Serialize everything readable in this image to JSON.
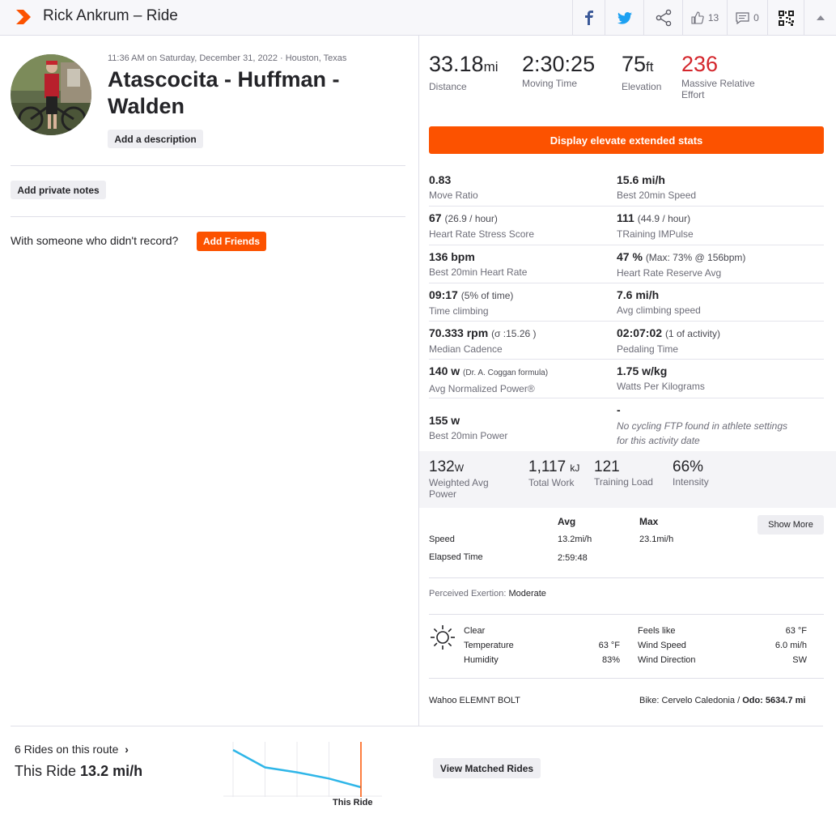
{
  "header": {
    "title": "Rick Ankrum – Ride",
    "kudos_count": "13",
    "comments_count": "0",
    "colors": {
      "brand": "#fc5200",
      "facebook": "#3b5998",
      "twitter": "#1da1f2"
    }
  },
  "activity": {
    "datetime": "11:36 AM on Saturday, December 31, 2022 · Houston, Texas",
    "title": "Atascocita - Huffman - Walden",
    "add_description": "Add a description",
    "add_private_notes": "Add private notes",
    "with_someone": "With someone who didn't record?",
    "add_friends": "Add Friends"
  },
  "summary": [
    {
      "value": "33.18",
      "unit": "mi",
      "label": "Distance"
    },
    {
      "value": "2:30:25",
      "unit": "",
      "label": "Moving Time"
    },
    {
      "value": "75",
      "unit": "ft",
      "label": "Elevation"
    },
    {
      "value": "236",
      "unit": "",
      "label": "Massive Relative Effort"
    }
  ],
  "elevate_button": "Display elevate extended stats",
  "extended": [
    {
      "left": {
        "value": "0.83",
        "extra": "",
        "label": "Move Ratio"
      },
      "right": {
        "value": "15.6 mi/h",
        "extra": "",
        "label": "Best 20min Speed"
      }
    },
    {
      "left": {
        "value": "67",
        "extra": "(26.9 / hour)",
        "label": "Heart Rate Stress Score"
      },
      "right": {
        "value": "111",
        "extra": "(44.9 / hour)",
        "label": "TRaining IMPulse"
      }
    },
    {
      "left": {
        "value": "136 bpm",
        "extra": "",
        "label": "Best 20min Heart Rate"
      },
      "right": {
        "value": "47 %",
        "extra": "(Max: 73% @ 156bpm)",
        "label": "Heart Rate Reserve Avg"
      }
    },
    {
      "left": {
        "value": "09:17",
        "extra": "(5% of time)",
        "label": "Time climbing"
      },
      "right": {
        "value": "7.6 mi/h",
        "extra": "",
        "label": "Avg climbing speed"
      }
    },
    {
      "left": {
        "value": "70.333 rpm",
        "extra": "(σ :15.26 )",
        "label": "Median Cadence"
      },
      "right": {
        "value": "02:07:02",
        "extra": "(1 of activity)",
        "label": "Pedaling Time"
      }
    },
    {
      "left": {
        "value": "140 w",
        "extra": "(Dr. A. Coggan formula)",
        "label": "Avg Normalized Power®"
      },
      "right": {
        "value": "1.75 w/kg",
        "extra": "",
        "label": "Watts Per Kilograms"
      }
    },
    {
      "left": {
        "value": "155 w",
        "extra": "",
        "label": "Best 20min Power"
      },
      "right": {
        "value": "-",
        "extra": "",
        "label": "No cycling FTP found in athlete settings for this activity date"
      }
    }
  ],
  "power": [
    {
      "value": "132",
      "unit": "W",
      "label": "Weighted Avg Power"
    },
    {
      "value": "1,117",
      "unit": "kJ",
      "label": "Total Work"
    },
    {
      "value": "121",
      "unit": "",
      "label": "Training Load"
    },
    {
      "value": "66%",
      "unit": "",
      "label": "Intensity"
    }
  ],
  "speed_table": {
    "col_avg": "Avg",
    "col_max": "Max",
    "rows": [
      {
        "label": "Speed",
        "avg": "13.2mi/h",
        "max": "23.1mi/h"
      },
      {
        "label": "Elapsed Time",
        "avg": "2:59:48",
        "max": ""
      }
    ],
    "show_more": "Show More"
  },
  "perceived": {
    "label": "Perceived Exertion:",
    "value": "Moderate"
  },
  "weather": {
    "condition": "Clear",
    "temperature_label": "Temperature",
    "temperature": "63 °F",
    "humidity_label": "Humidity",
    "humidity": "83%",
    "feels_like_label": "Feels like",
    "feels_like": "63 °F",
    "wind_speed_label": "Wind Speed",
    "wind_speed": "6.0 mi/h",
    "wind_dir_label": "Wind Direction",
    "wind_dir": "SW"
  },
  "device": "Wahoo ELEMNT BOLT",
  "bike": {
    "prefix": "Bike: Cervelo Caledonia /",
    "odo": "Odo: 5634.7 mi"
  },
  "matched": {
    "rides_on_route": "6 Rides on this route",
    "this_ride_label": "This Ride",
    "this_ride_value": "13.2 mi/h",
    "view_button": "View Matched Rides",
    "chart_marker_label": "This Ride",
    "speeds": [
      16.2,
      14.8,
      14.4,
      13.9,
      13.2
    ]
  }
}
